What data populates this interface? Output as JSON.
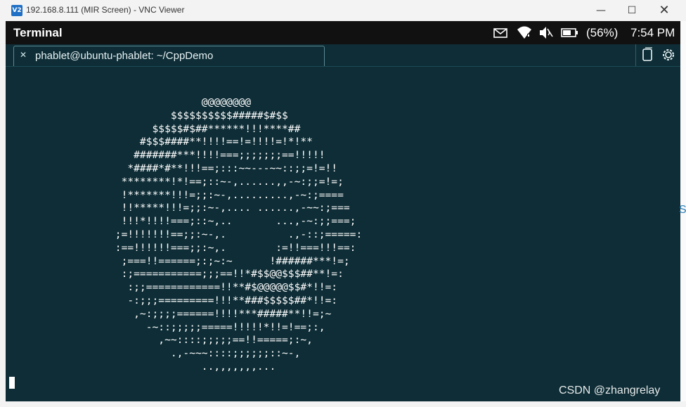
{
  "vnc": {
    "icon_text": "V2",
    "title": "192.168.8.111 (MIR Screen) - VNC Viewer",
    "minimize": "—",
    "maximize": "☐",
    "close": "✕"
  },
  "indicators": {
    "app_name": "Terminal",
    "mail_icon": "mail-icon",
    "wifi_icon": "wifi-icon",
    "volume_icon": "volume-muted-icon",
    "battery_icon": "battery-icon",
    "battery_percent": "(56%)",
    "time": "7:54 PM"
  },
  "tab": {
    "close": "✕",
    "label": "phablet@ubuntu-phablet: ~/CppDemo"
  },
  "terminal": {
    "ascii_art": "               @@@@@@@@\n          $$$$$$$$$$#####$#$$\n       $$$$$#$##******!!!****##\n     #$$$####**!!!!==!=!!!!=!*!**\n    #######***!!!!===;;;;;;;==!!!!!\n   *####*#**!!!==;:::~~---~~::;;=!=!!\n  ********!*!==;::~-,......,,-~:;;=!=;\n  !*******!!!=;;:~-,.........,-~:;====\n  !!*****!!!=;;:~-,.... ......,-~~:;===\n  !!!*!!!!===;::~,..       ...,-~:;;===;\n ;=!!!!!!!==;;:~-,.          .,-::;=====:\n :==!!!!!!===;;:~,.        :=!!===!!!==:\n  ;===!!======;:;~:~      !######***!=;\n  :;===========;;;==!!*#$$@@$$$##**!=:\n   :;;============!!**#$@@@@@$$#*!!=:\n   -:;;;=========!!!**###$$$$$##*!!=:\n    ,~:;;;;======!!!!***#####**!!=;~\n      -~::;;;;;=====!!!!!*!!=!==;:,\n        ,~~::::;;;;;==!!=====;:~,\n          .,-~~~::::;;;;;;::~-,\n               ..,,,,,,,..."
  },
  "watermark": "CSDN @zhangrelay",
  "side_char": "S"
}
